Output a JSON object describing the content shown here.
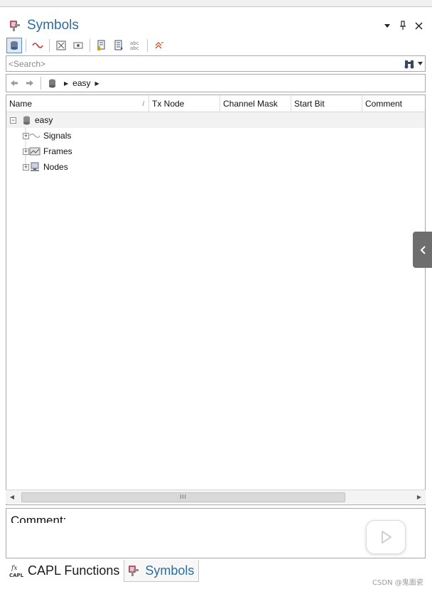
{
  "panel": {
    "title": "Symbols",
    "title_color": "#2f6d9a",
    "controls": [
      "dropdown-arrow-icon",
      "pin-icon",
      "close-icon"
    ],
    "dropdown_glyph": "▼",
    "pin_glyph": "📌",
    "close_glyph": "✕"
  },
  "toolbar": {
    "buttons": [
      {
        "icon": "database-icon",
        "active": true
      },
      {
        "icon": "signal-wave-icon",
        "active": false
      },
      {
        "icon": "expand-all-icon",
        "active": false
      },
      {
        "icon": "collapse-all-icon",
        "active": false
      },
      {
        "icon": "copy-icon",
        "active": false
      },
      {
        "icon": "document-icon",
        "active": false
      },
      {
        "icon": "abc-naming-icon",
        "active": false,
        "text": "abc"
      },
      {
        "icon": "up-chevron-icon",
        "active": false
      }
    ]
  },
  "search": {
    "placeholder": "<Search>",
    "value": ""
  },
  "nav": {
    "breadcrumb_root_icon": "database-icon",
    "breadcrumb": "easy"
  },
  "grid": {
    "columns": [
      "Name",
      "Tx Node",
      "Channel Mask",
      "Start Bit",
      "Comment"
    ],
    "rows": [
      {
        "label": "easy",
        "icon": "database-icon",
        "expanded": true,
        "level": 0
      },
      {
        "label": "Signals",
        "icon": "signal-wave-icon",
        "expanded": false,
        "level": 1
      },
      {
        "label": "Frames",
        "icon": "frame-icon",
        "expanded": false,
        "level": 1
      },
      {
        "label": "Nodes",
        "icon": "node-computer-icon",
        "expanded": false,
        "level": 1
      }
    ]
  },
  "scrollbar": {
    "thumb_grip": "III"
  },
  "comment": {
    "label": "Comment:"
  },
  "bottom_tabs": [
    {
      "label": "CAPL Functions",
      "icon": "capl-fx-icon",
      "active": false
    },
    {
      "label": "Symbols",
      "icon": "symbols-icon",
      "active": true
    }
  ],
  "watermark": "CSDN @鬼面瓷",
  "colors": {
    "accent": "#2f6d9a",
    "side_tab": "#6e6e6e",
    "selection_border": "#5b8fc7"
  }
}
